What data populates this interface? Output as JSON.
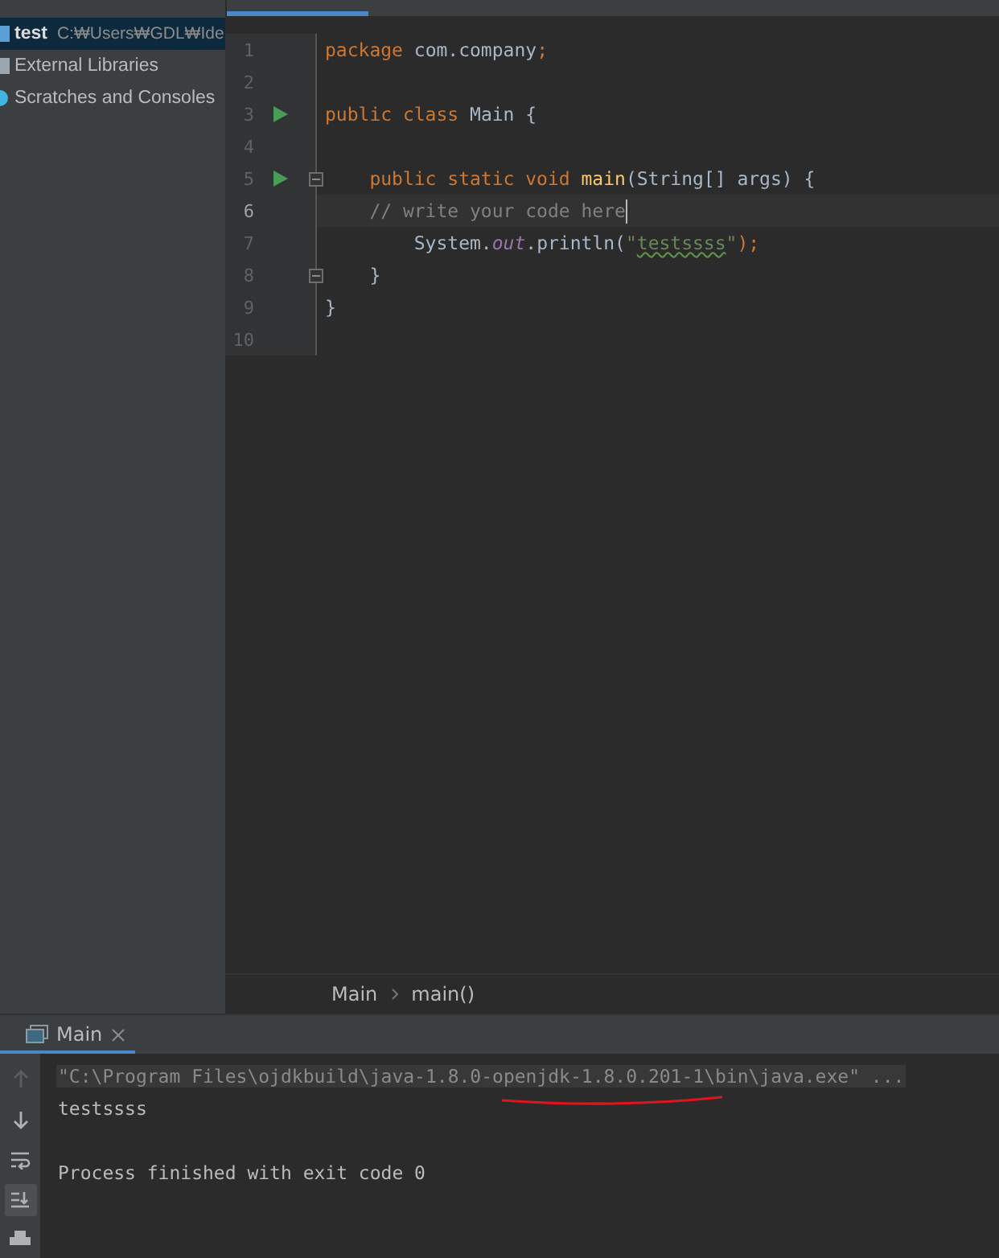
{
  "project_tree": {
    "items": [
      {
        "name": "test",
        "path": "C:₩Users₩GDL₩Ide",
        "selected": true,
        "kind": "module"
      },
      {
        "name": "External Libraries",
        "selected": false,
        "kind": "libraries"
      },
      {
        "name": "Scratches and Consoles",
        "selected": false,
        "kind": "scratches"
      }
    ]
  },
  "editor": {
    "lines": [
      {
        "number": "1",
        "current": false,
        "run": false,
        "fold": false,
        "tokens": [
          {
            "text": "package ",
            "kind": "keyword"
          },
          {
            "text": "com.company",
            "kind": "plain"
          },
          {
            "text": ";",
            "kind": "keyword"
          }
        ]
      },
      {
        "number": "2",
        "current": false,
        "run": false,
        "fold": false
      },
      {
        "number": "3",
        "current": false,
        "run": true,
        "fold": false,
        "tokens": [
          {
            "text": "public class ",
            "kind": "keyword"
          },
          {
            "text": "Main {",
            "kind": "plain"
          }
        ]
      },
      {
        "number": "4",
        "current": false,
        "run": false,
        "fold": false
      },
      {
        "number": "5",
        "current": false,
        "run": true,
        "fold": true,
        "tokens": [
          {
            "text": "    public static void ",
            "kind": "keyword"
          },
          {
            "text": "main",
            "kind": "method"
          },
          {
            "text": "(String[] args) {",
            "kind": "plain"
          }
        ]
      },
      {
        "number": "6",
        "current": true,
        "run": false,
        "fold": false,
        "tokens": [
          {
            "text": "    // write your code here",
            "kind": "comment"
          }
        ]
      },
      {
        "number": "7",
        "current": false,
        "run": false,
        "fold": false,
        "tokens": [
          {
            "text": "        System.",
            "kind": "plain"
          },
          {
            "text": "out",
            "kind": "field"
          },
          {
            "text": ".println(",
            "kind": "plain"
          },
          {
            "text": "\"",
            "kind": "string"
          },
          {
            "text": "testssss",
            "kind": "typo"
          },
          {
            "text": "\"",
            "kind": "string"
          },
          {
            "text": ");",
            "kind": "keyword"
          }
        ]
      },
      {
        "number": "8",
        "current": false,
        "run": false,
        "fold": true,
        "tokens": [
          {
            "text": "    }",
            "kind": "plain"
          }
        ]
      },
      {
        "number": "9",
        "current": false,
        "run": false,
        "fold": false,
        "tokens": [
          {
            "text": "}",
            "kind": "plain"
          }
        ]
      },
      {
        "number": "10",
        "current": false,
        "run": false,
        "fold": false
      }
    ],
    "breadcrumbs": [
      "Main",
      "main()"
    ]
  },
  "run_panel": {
    "tab": {
      "label": "Main",
      "selected": true
    },
    "toolbar": [
      {
        "kind": "up",
        "disabled": true,
        "selected": false
      },
      {
        "kind": "down",
        "disabled": false,
        "selected": false
      },
      {
        "kind": "wrap",
        "disabled": false,
        "selected": false
      },
      {
        "kind": "scroll",
        "disabled": false,
        "selected": true
      },
      {
        "kind": "print",
        "disabled": false,
        "selected": false
      }
    ],
    "console": [
      {
        "text": "\"C:\\Program Files\\ojdkbuild\\java-1.8.0-openjdk-1.8.0.201-1\\bin\\java.exe\" ...",
        "kind": "command"
      },
      {
        "text": "testssss",
        "kind": "output"
      },
      {
        "text": "Process finished with exit code 0",
        "kind": "exit"
      }
    ]
  }
}
